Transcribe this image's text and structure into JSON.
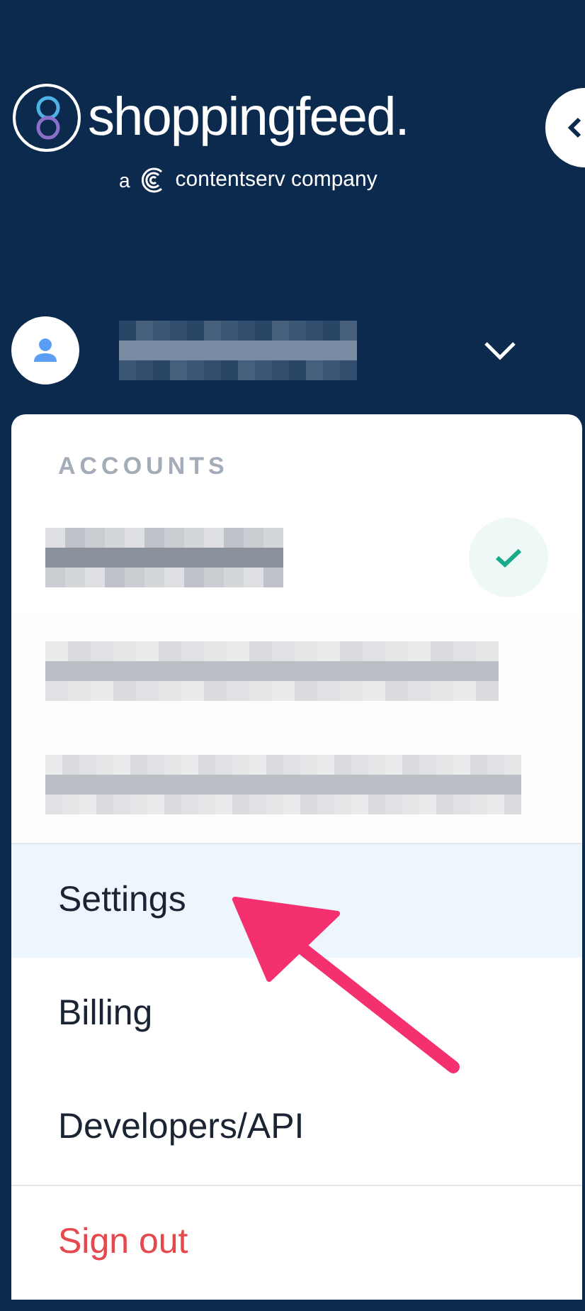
{
  "logo": {
    "name": "shoppingfeed.",
    "tagline_prefix": "a",
    "tagline_suffix": "contentserv company"
  },
  "accounts_menu": {
    "section_title": "ACCOUNTS",
    "accounts": [
      {
        "selected": true
      },
      {
        "selected": false
      },
      {
        "selected": false
      }
    ],
    "items": [
      {
        "label": "Settings",
        "kind": "link",
        "selected": true
      },
      {
        "label": "Billing",
        "kind": "link",
        "selected": false
      },
      {
        "label": "Developers/API",
        "kind": "link",
        "selected": false
      },
      {
        "label": "Sign out",
        "kind": "danger",
        "selected": false
      }
    ]
  }
}
